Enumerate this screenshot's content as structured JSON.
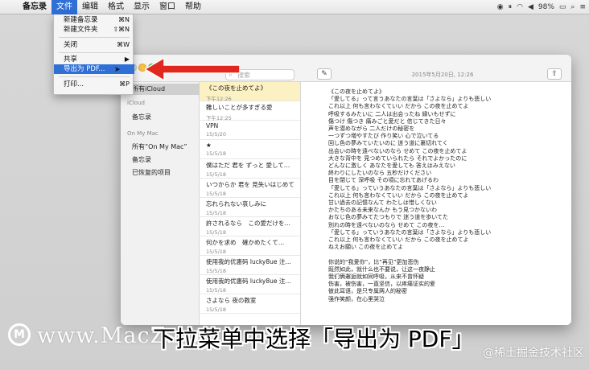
{
  "menubar": {
    "app_name": "备忘录",
    "items": [
      "文件",
      "编辑",
      "格式",
      "显示",
      "窗口",
      "帮助"
    ],
    "battery": "98%"
  },
  "file_menu": {
    "items": [
      {
        "label": "新建备忘录",
        "shortcut": "⌘N"
      },
      {
        "label": "新建文件夹",
        "shortcut": "⇧⌘N"
      },
      {
        "label": "关闭",
        "shortcut": "⌘W"
      },
      {
        "label": "共享",
        "shortcut": "▶"
      },
      {
        "label": "导出为 PDF...",
        "shortcut": ""
      },
      {
        "label": "打印...",
        "shortcut": "⌘P"
      }
    ]
  },
  "window": {
    "search_placeholder": "搜索",
    "date": "2015年5月20日, 12:26"
  },
  "sidebar": {
    "items": [
      {
        "label": "所有iCloud",
        "kind": "item"
      },
      {
        "label": "iCloud",
        "kind": "header"
      },
      {
        "label": "备忘录",
        "kind": "item"
      },
      {
        "label": "On My Mac",
        "kind": "header"
      },
      {
        "label": "所有“On My Mac”",
        "kind": "item"
      },
      {
        "label": "备忘录",
        "kind": "item"
      },
      {
        "label": "已恢复的项目",
        "kind": "item"
      }
    ]
  },
  "notes": [
    {
      "title": "《この夜を止めてよ》",
      "date": "下午12:26"
    },
    {
      "title": "難しいことが多すぎる愛",
      "date": "下午12:25"
    },
    {
      "title": "VPN",
      "date": "15/5/20"
    },
    {
      "title": "★",
      "date": "15/5/18"
    },
    {
      "title": "僕はただ 君を ずっと 愛して…",
      "date": "15/5/18"
    },
    {
      "title": "いつからか 君を 見失いはじめて",
      "date": "15/5/18"
    },
    {
      "title": "忘れられない哀しみに",
      "date": "15/5/18"
    },
    {
      "title": "許されるなら　この愛だけを…",
      "date": "15/5/18"
    },
    {
      "title": "何かを求め　確かめたくて…",
      "date": "15/5/18"
    },
    {
      "title": "使用我的优惠码 lucky8ue 注…",
      "date": "15/5/18"
    },
    {
      "title": "使用我的优惠码 lucky8ue 注…",
      "date": "15/5/18"
    },
    {
      "title": "さよなら 夜の教室",
      "date": "15/5/18"
    }
  ],
  "note_body": [
    "《この夜を止めてよ》",
    "「愛してる」って言うあなたの言葉は「さよなら」よりも悲しい",
    "これ以上 何も言わなくていい だから この夜を止めてよ",
    "呼吸するみたいに 二人は出会ったね 縁いもせずに",
    "傷つけ 傷つき 痛みごと愛だと 信じてきた日々",
    "声を潜めながら 二人だけの秘密を",
    "一つずつ増やすたび 作り笑い 心で泣いてる",
    "回し色の夢みていたいのに 迷う道に裏切れてく",
    "出会いの時を遠べないのなら せめて この夜を止めてよ",
    "大きな背中を 見つめていられたら それでよかったのに",
    "どんなに激しく あなたを愛しても 答えはみえない",
    "終わりにしたいのなら 五秒だけください",
    "目を閉じて 深呼吸 その頃に忘れてあげるわ",
    "「愛してる」っていうあなたの言葉は「さよなら」よりも悲しい",
    "これ以上 何も言わなくていい だから この夜を止めてよ",
    "甘い過去の記憶なんて わたしは惜しくない",
    "かたちのある未来なんか もう見つかないわ",
    "おなじ色の夢みてたつもりで 迷う道を歩いてた",
    "別れの時を遠べないのなら せめて この夜を…",
    "「愛してる」っていうあなたの言葉は「さよなら」よりも悲しい",
    "これ以上 何も言わなくていい だから この夜を止めてよ",
    "ねえお願い この夜を止めてよ",
    "",
    "你说的“我爱你”，比“再见”更加悲伤",
    "既然如此，就什么也不要说，让这一夜静止",
    "我们俩邂逅就如同呼吸，从来不曾怀疑",
    "伤害，被伤害，一直坚信，以疼痛证实的爱",
    "彼此耳语，是只专属两人的秘密",
    "强作笑颜，在心里哭泣"
  ],
  "banner": {
    "logo_letter": "M",
    "watermark": "www.MacZ.com",
    "subtitle": "下拉菜单中选择「导出为 PDF」",
    "corner": "@稀土掘金技术社区"
  },
  "colors": {
    "accent": "#2f6fd6",
    "arrow": "#e0281e",
    "selected_note": "#fbf1c3"
  }
}
